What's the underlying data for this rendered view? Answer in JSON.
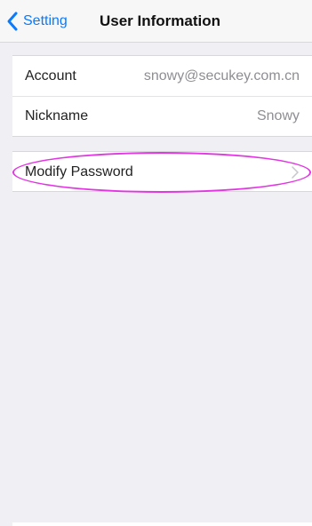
{
  "nav": {
    "back_label": "Setting",
    "title": "User Information"
  },
  "account_section": {
    "account": {
      "label": "Account",
      "value": "snowy@secukey.com.cn"
    },
    "nickname": {
      "label": "Nickname",
      "value": "Snowy"
    }
  },
  "security_section": {
    "modify_password": {
      "label": "Modify Password"
    }
  },
  "colors": {
    "accent": "#0a7aff",
    "highlight": "#e236e2",
    "background": "#efeff4"
  },
  "icons": {
    "back": "chevron-left-icon",
    "disclosure": "chevron-right-icon"
  }
}
